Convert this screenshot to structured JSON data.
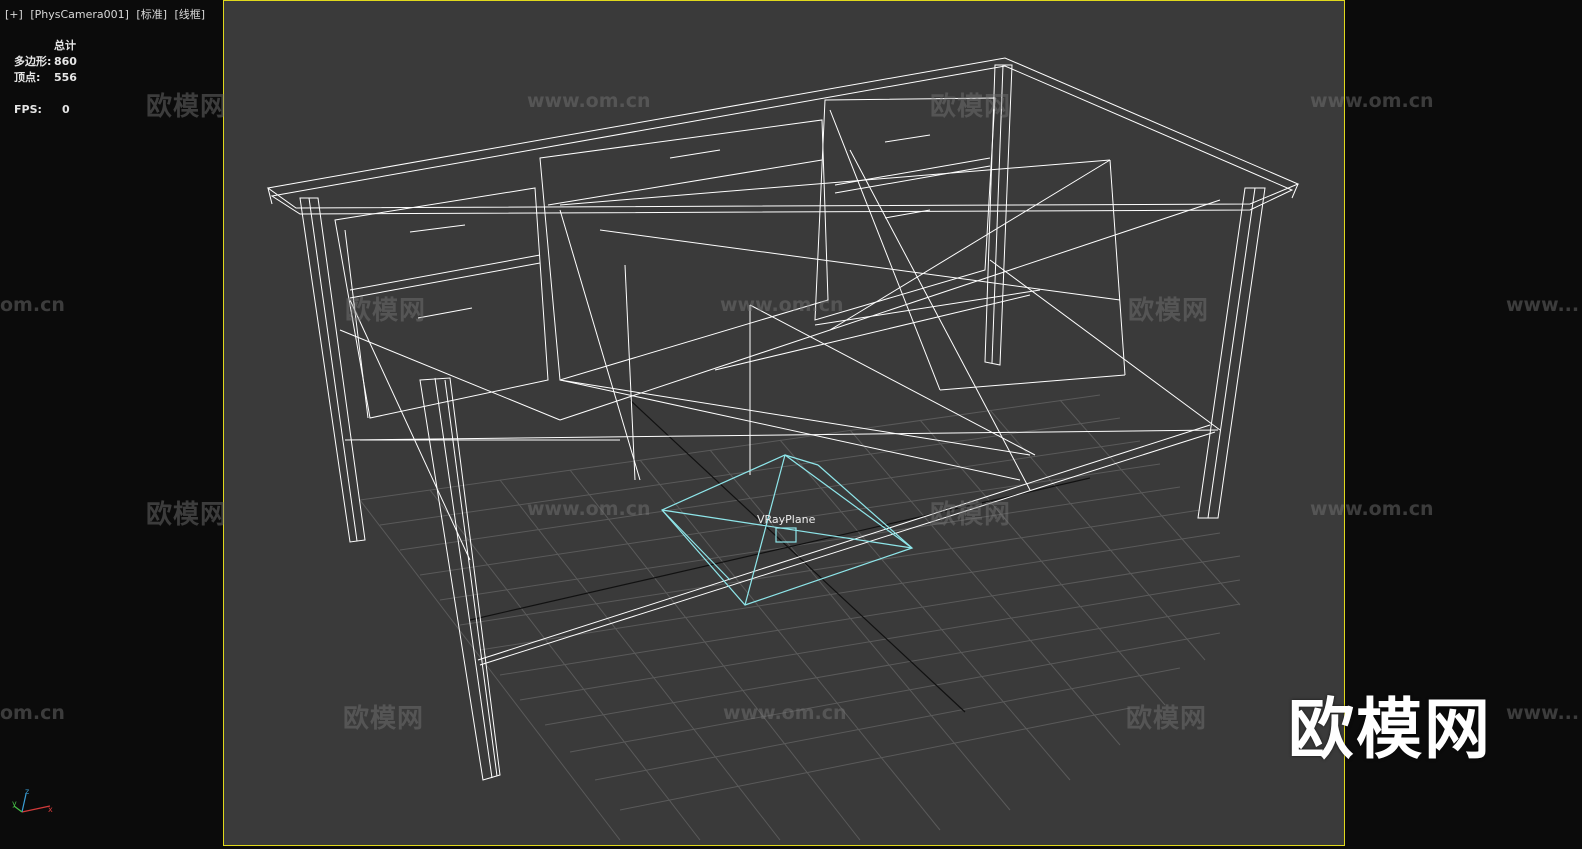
{
  "viewport_menu": [
    "[+]",
    "[PhysCamera001]",
    "[标准]",
    "[线框]"
  ],
  "stats": {
    "header": "总计",
    "polygons_label": "多边形:",
    "polygons_value": "860",
    "vertices_label": "顶点:",
    "vertices_value": "556",
    "fps_label": "FPS:",
    "fps_value": "0"
  },
  "object_label": "VRayPlane",
  "watermark": {
    "cn": "欧模网",
    "url": "www.om.cn",
    "url_short": "om.cn",
    "url_partial": "www..."
  },
  "brand_logo": "欧模网",
  "colors": {
    "viewport_bg": "#3a3a3a",
    "frame": "#e0d81c",
    "wire": "#ffffff",
    "grid": "#5a5a5a",
    "vray": "#8ee6ea"
  },
  "icons": [
    "axis-gizmo-icon"
  ]
}
